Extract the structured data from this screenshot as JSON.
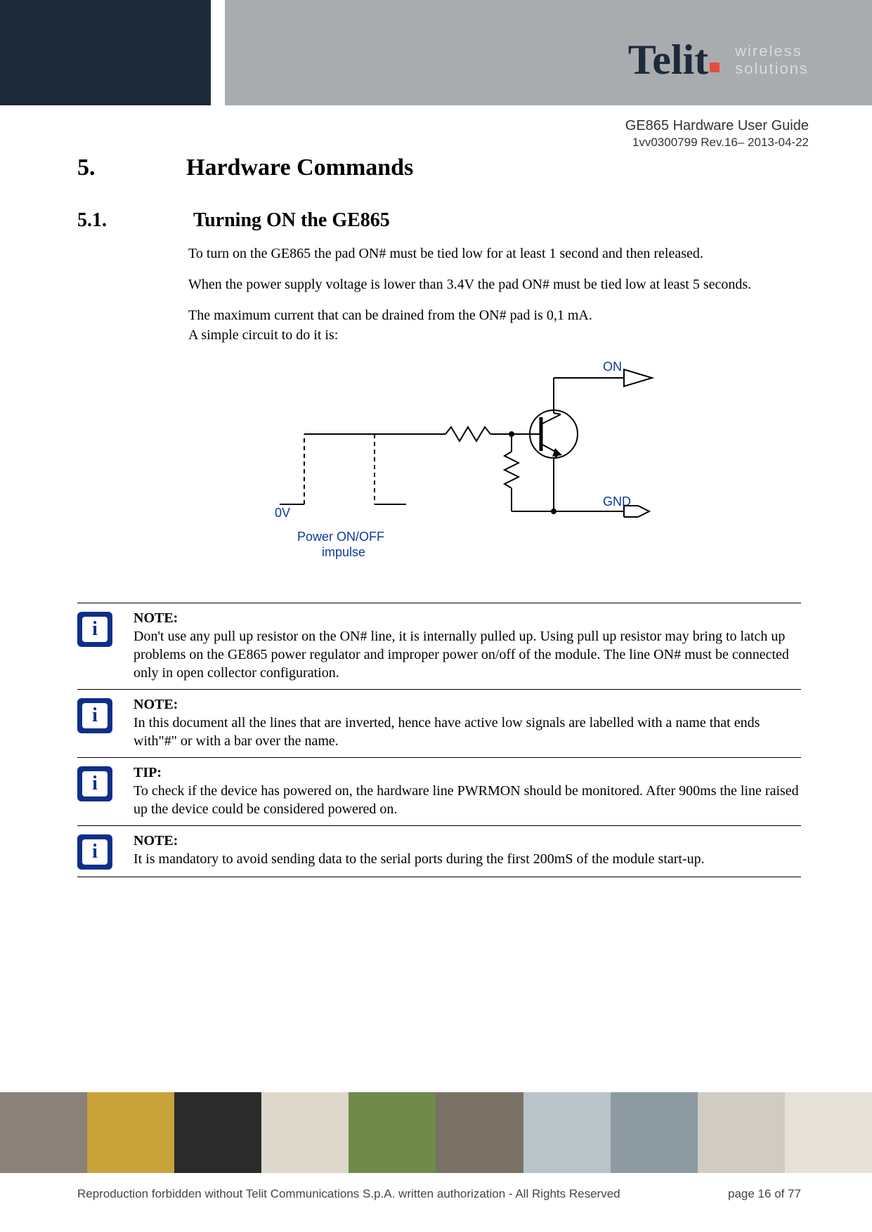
{
  "logo": {
    "brand": "Telit",
    "tag1": "wireless",
    "tag2": "solutions"
  },
  "doc": {
    "title": "GE865 Hardware User Guide",
    "rev": "1vv0300799 Rev.16– 2013-04-22"
  },
  "chapter": {
    "num": "5.",
    "title": "Hardware Commands"
  },
  "section": {
    "num": "5.1.",
    "title": "Turning ON the GE865"
  },
  "paras": {
    "p1": "To turn on the GE865 the pad ON# must be tied low for at least 1 second and then released.",
    "p2": "When the power supply voltage is lower than 3.4V the pad ON# must be tied low at least 5 seconds.",
    "p3a": "The maximum current that can be drained from the ON# pad is 0,1 mA.",
    "p3b": "A simple circuit to do it is:"
  },
  "diagram": {
    "on": "ON",
    "gnd": "GND",
    "ov": "0V",
    "caption1": "Power ON/OFF",
    "caption2": "impulse"
  },
  "notes": [
    {
      "label": "NOTE:",
      "text": "Don't use any pull up resistor on the ON# line, it is internally pulled up. Using pull up resistor may bring to latch up problems on the GE865 power regulator and improper power on/off of the module. The line ON# must be connected only in open collector configuration."
    },
    {
      "label": "NOTE:",
      "text": "In this document all the lines that are inverted, hence have active low signals are labelled with a name that ends with\"#\" or with a bar over the name."
    },
    {
      "label": "TIP:",
      "text": "To check if the device has powered on, the hardware line PWRMON should be monitored. After 900ms the line raised up the device could be considered powered on."
    },
    {
      "label": "NOTE:",
      "text": "It is mandatory to avoid sending data to the serial ports during the first 200mS of the module start-up."
    }
  ],
  "footer": {
    "copyright": "Reproduction forbidden without Telit Communications S.p.A. written authorization - All Rights Reserved",
    "page": "page 16 of 77",
    "colors": [
      "#8a8278",
      "#c9a23a",
      "#2b2b2b",
      "#ded7cb",
      "#6f8a4a",
      "#7a7266",
      "#b9c4c9",
      "#8e9aa2",
      "#d0ccc3",
      "#e5e1d8"
    ]
  },
  "icon_glyph": "i"
}
